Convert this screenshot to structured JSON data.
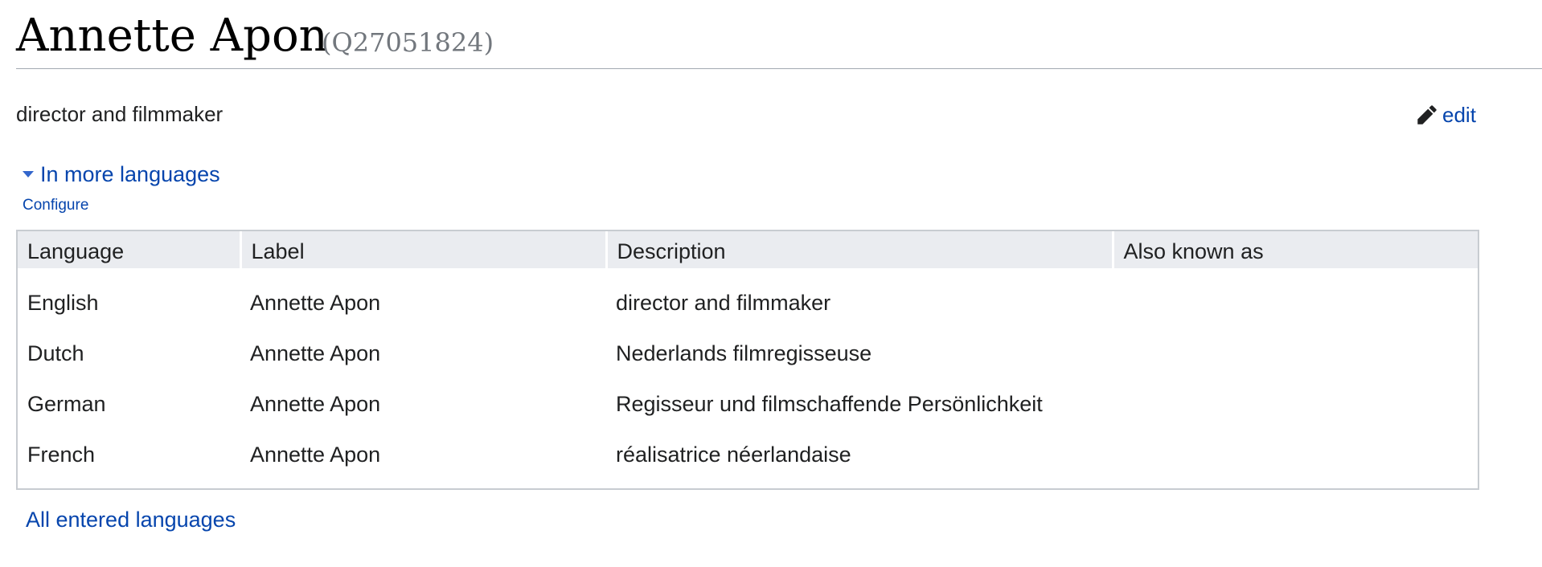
{
  "heading": {
    "label": "Annette Apon",
    "entity_id": "(Q27051824)"
  },
  "description": "director and filmmaker",
  "edit": {
    "label": "edit",
    "icon": "pencil-icon"
  },
  "languages_toggle": {
    "label": "In more languages",
    "icon": "triangle-down-icon",
    "expanded": true
  },
  "configure_label": "Configure",
  "table": {
    "headers": [
      "Language",
      "Label",
      "Description",
      "Also known as"
    ],
    "rows": [
      [
        "English",
        "Annette Apon",
        "director and filmmaker",
        ""
      ],
      [
        "Dutch",
        "Annette Apon",
        "Nederlands filmregisseuse",
        ""
      ],
      [
        "German",
        "Annette Apon",
        "Regisseur und filmschaffende Persönlichkeit",
        ""
      ],
      [
        "French",
        "Annette Apon",
        "réalisatrice néerlandaise",
        ""
      ]
    ]
  },
  "all_languages_label": "All entered languages",
  "colors": {
    "link": "#0645ad",
    "text": "#202122",
    "muted": "#72777d",
    "header_bg": "#eaecf0",
    "border": "#c8ccd1"
  }
}
